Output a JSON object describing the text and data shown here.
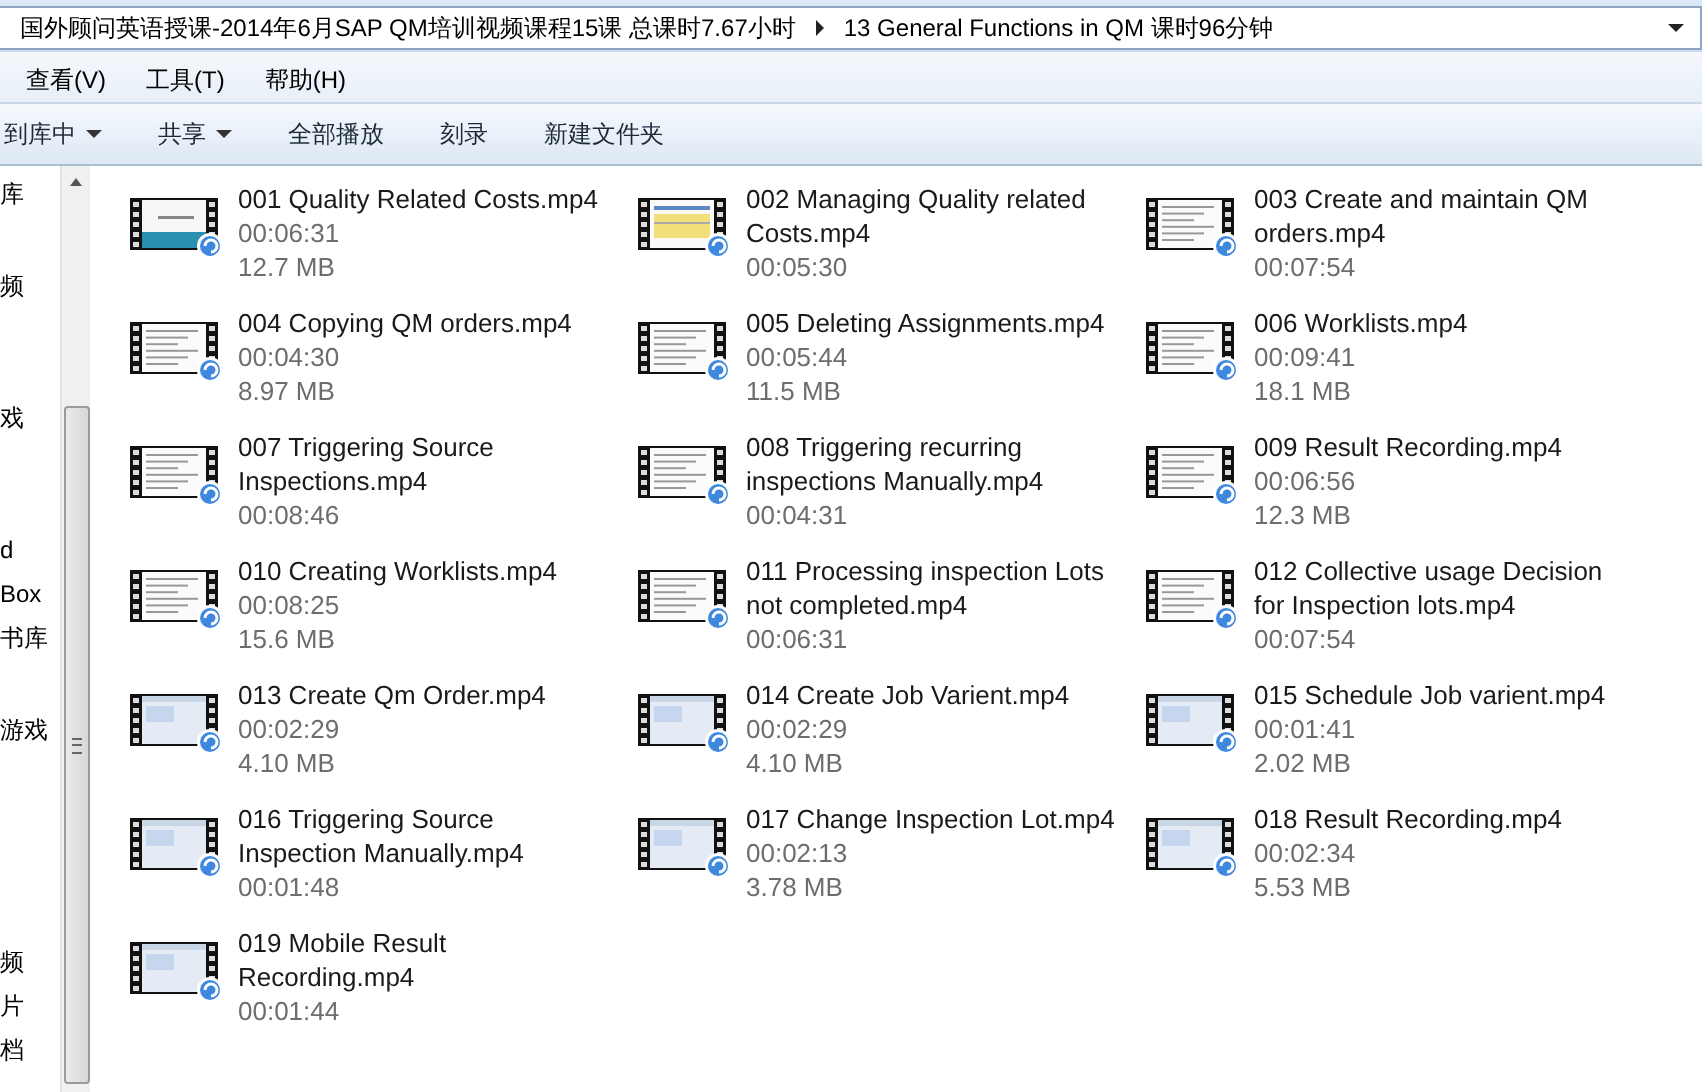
{
  "address_bar": {
    "crumbs": [
      "国外顾问英语授课-2014年6月SAP QM培训视频课程15课  总课时7.67小时",
      "13 General Functions in QM 课时96分钟"
    ]
  },
  "menu": [
    "查看(V)",
    "工具(T)",
    "帮助(H)"
  ],
  "toolbar": [
    {
      "label": "到库中",
      "dropdown": true
    },
    {
      "label": "共享",
      "dropdown": true
    },
    {
      "label": "全部播放",
      "dropdown": false
    },
    {
      "label": "刻录",
      "dropdown": false
    },
    {
      "label": "新建文件夹",
      "dropdown": false
    }
  ],
  "sidebar": {
    "items": [
      "库",
      "频",
      "戏",
      "d",
      "Box",
      "书库",
      "游戏",
      "频",
      "片",
      "档"
    ]
  },
  "files": [
    {
      "name": [
        "001 Quality Related Costs.mp4"
      ],
      "meta": [
        "00:06:31",
        "12.7 MB"
      ],
      "kind": "title"
    },
    {
      "name": [
        "002 Managing Quality related",
        "Costs.mp4"
      ],
      "meta": [
        "00:05:30"
      ],
      "kind": "table"
    },
    {
      "name": [
        "003 Create and maintain QM",
        "orders.mp4"
      ],
      "meta": [
        "00:07:54"
      ],
      "kind": "text"
    },
    {
      "name": [
        "004 Copying QM orders.mp4"
      ],
      "meta": [
        "00:04:30",
        "8.97 MB"
      ],
      "kind": "text"
    },
    {
      "name": [
        "005 Deleting Assignments.mp4"
      ],
      "meta": [
        "00:05:44",
        "11.5 MB"
      ],
      "kind": "text"
    },
    {
      "name": [
        "006 Worklists.mp4"
      ],
      "meta": [
        "00:09:41",
        "18.1 MB"
      ],
      "kind": "text"
    },
    {
      "name": [
        "007 Triggering Source",
        "Inspections.mp4"
      ],
      "meta": [
        "00:08:46"
      ],
      "kind": "text"
    },
    {
      "name": [
        "008 Triggering recurring",
        "inspections Manually.mp4"
      ],
      "meta": [
        "00:04:31"
      ],
      "kind": "text"
    },
    {
      "name": [
        "009 Result Recording.mp4"
      ],
      "meta": [
        "00:06:56",
        "12.3 MB"
      ],
      "kind": "text"
    },
    {
      "name": [
        "010 Creating Worklists.mp4"
      ],
      "meta": [
        "00:08:25",
        "15.6 MB"
      ],
      "kind": "text"
    },
    {
      "name": [
        "011 Processing inspection Lots",
        "not completed.mp4"
      ],
      "meta": [
        "00:06:31"
      ],
      "kind": "text"
    },
    {
      "name": [
        "012 Collective usage Decision",
        "for Inspection lots.mp4"
      ],
      "meta": [
        "00:07:54"
      ],
      "kind": "text"
    },
    {
      "name": [
        "013 Create Qm Order.mp4"
      ],
      "meta": [
        "00:02:29",
        "4.10 MB"
      ],
      "kind": "screen"
    },
    {
      "name": [
        "014 Create Job Varient.mp4"
      ],
      "meta": [
        "00:02:29",
        "4.10 MB"
      ],
      "kind": "screen"
    },
    {
      "name": [
        "015 Schedule Job varient.mp4"
      ],
      "meta": [
        "00:01:41",
        "2.02 MB"
      ],
      "kind": "screen"
    },
    {
      "name": [
        "016 Triggering Source",
        "Inspection Manually.mp4"
      ],
      "meta": [
        "00:01:48"
      ],
      "kind": "screen"
    },
    {
      "name": [
        "017 Change Inspection Lot.mp4"
      ],
      "meta": [
        "00:02:13",
        "3.78 MB"
      ],
      "kind": "screen"
    },
    {
      "name": [
        "018 Result Recording.mp4"
      ],
      "meta": [
        "00:02:34",
        "5.53 MB"
      ],
      "kind": "screen"
    },
    {
      "name": [
        "019 Mobile Result",
        "Recording.mp4"
      ],
      "meta": [
        "00:01:44"
      ],
      "kind": "screen"
    }
  ]
}
